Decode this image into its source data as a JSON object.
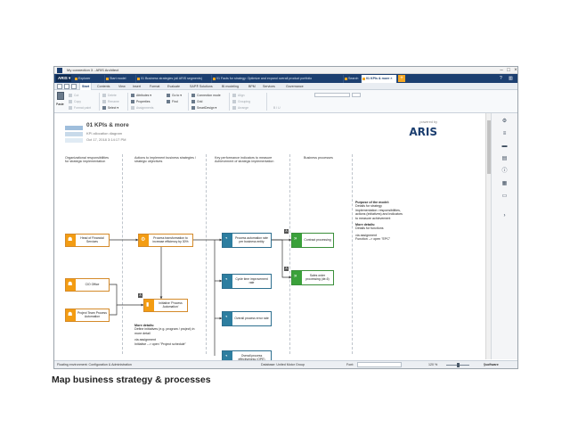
{
  "window": {
    "title": "My connection 3 - ARIS Architect"
  },
  "tabbar": {
    "aris_label": "ARIS",
    "tabs": [
      {
        "label": "Explorer"
      },
      {
        "label": "Start model"
      },
      {
        "label": "01 Business strategies (all ARIS segments)"
      },
      {
        "label": "01 Facts for strategy: Optimize and expand overall product portfolio"
      },
      {
        "label": "Search"
      },
      {
        "label": "01 KPIs & more"
      }
    ],
    "add_label": "+",
    "help_label": "?"
  },
  "menubar": {
    "items": [
      "Start",
      "Contents",
      "View",
      "Insert",
      "Format",
      "Evaluate",
      "SAP® Solutions",
      "BI modeling",
      "BPM",
      "Services",
      "Governance"
    ],
    "active": "Start"
  },
  "ribbon": {
    "paste": "Paste",
    "cut": "Cut",
    "copy": "Copy",
    "format_paint": "Format paint",
    "delete": "Delete",
    "rename": "Rename",
    "select": "Select",
    "attributes": "Attributes",
    "properties": "Properties",
    "assignments": "Assignments",
    "goto": "Go to",
    "find": "Find",
    "connection_mode": "Connection mode",
    "grid": "Grid",
    "smartdesign": "SmartDesign",
    "align": "Align",
    "grouping": "Grouping",
    "arrange": "Arrange"
  },
  "document": {
    "title": "01 KPIs & more",
    "subtitle": "KPI allocation diagram",
    "date": "Oct 17, 2018 3:14:17 PM",
    "powered_by": "powered by",
    "logo": "ARIS"
  },
  "lanes": [
    {
      "header": [
        "Organizational responsibilities",
        "for strategic implementation"
      ]
    },
    {
      "header": [
        "Actions to implement business strategies /",
        "strategic objectives"
      ]
    },
    {
      "header": [
        "Key performance indicators to measure",
        "Achievement of strategic implementation"
      ]
    },
    {
      "header": [
        "Business processes"
      ]
    }
  ],
  "nodes": {
    "head_of_finance": "Head of Financial Services",
    "cio_office": "CIO Office",
    "project_team": "Project Team Process Automation",
    "process_transformation": "Process transformation to increase efficiency by 30%",
    "initiative": "Initiative 'Process Automation'",
    "kpi_automation": "Process automation rate per business entity",
    "kpi_cycle_time": "Cycle time improvement rate",
    "kpi_error_rate": "Overall process error rate",
    "kpi_ope": "Overall process effectiveness (OPE)",
    "contract_processing": "Contract processing",
    "sales_order": "Sales order processing (de-6)"
  },
  "notes": {
    "more_details_heading": "More details:",
    "more_details_text": [
      "Define initiatives (e.g. program / project) in",
      "more detail"
    ],
    "via_assignment": "via assignment",
    "initiative_open": "Initiative --> open \"Project schedule\"",
    "purpose_heading": "Purpose of the model:",
    "purpose_text": [
      "Details for strategy",
      "implementation: responsibilities,",
      "actions (initiatives) and indicators",
      "to measure achievement"
    ],
    "right_more_heading": "More details:",
    "right_more_text": "Details for functions",
    "right_via": "via assignment",
    "function_open": "Function --> open \"EPC\""
  },
  "statusbar": {
    "left": "Floating environment: Configuration & Administration",
    "database": "Database: United Motor Group",
    "font": "Font:",
    "zoom": "120 %",
    "brand": "software"
  },
  "caption": "Map business strategy & processes",
  "colors": {
    "accent_navy": "#1c3f70",
    "org_orange": "#f39c12",
    "process_green": "#3aa13a",
    "kpi_blue": "#2d7ea0"
  }
}
